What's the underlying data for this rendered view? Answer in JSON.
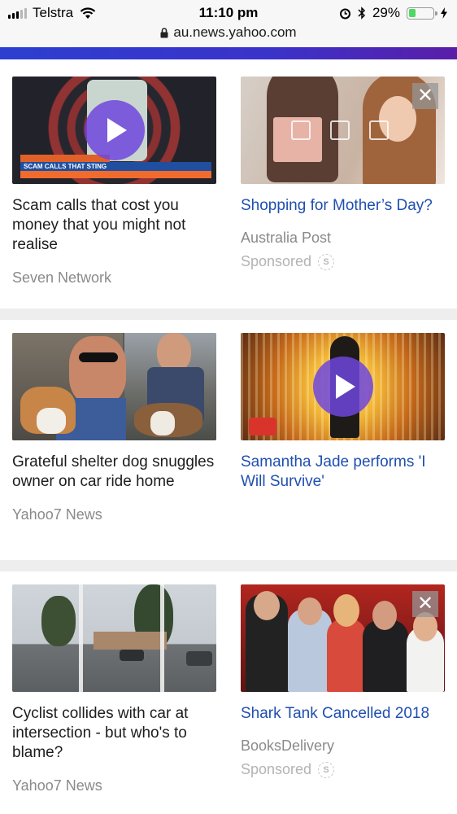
{
  "status_bar": {
    "carrier": "Telstra",
    "time": "11:10 pm",
    "battery_percent": "29%",
    "battery_level": 0.29,
    "url": "au.news.yahoo.com",
    "signal_bars": 5,
    "signal_active": 3
  },
  "rows": [
    {
      "left": {
        "title": "Scam calls that cost you money that you might not realise",
        "source": "Seven Network",
        "thumb_text": "SCAM CALLS THAT STING",
        "has_play": true
      },
      "right": {
        "title": "Shopping for Mother’s Day?",
        "source": "Australia Post",
        "sponsored": "Sponsored",
        "has_close": true
      }
    },
    {
      "left": {
        "title": "Grateful shelter dog snuggles owner on car ride home",
        "source": "Yahoo7 News"
      },
      "right": {
        "title": "Samantha Jade performs 'I Will Survive'",
        "has_play": true
      }
    },
    {
      "left": {
        "title": "Cyclist collides with car at intersection - but who's to blame?",
        "source": "Yahoo7 News"
      },
      "right": {
        "title": "Shark Tank Cancelled 2018",
        "source": "BooksDelivery",
        "sponsored": "Sponsored",
        "has_close": true
      }
    }
  ],
  "colors": {
    "accent_bar_start": "#2d3fd0",
    "accent_bar_end": "#5a1ea8",
    "ad_title": "#1f4fb0",
    "article_title": "#1d1d1d",
    "source_text": "#8a8a8a",
    "battery": "#4cd964"
  },
  "icons": {
    "play": "play-icon",
    "close": "close-icon",
    "sponsored": "sponsored-info-icon",
    "lock": "lock-icon",
    "wifi": "wifi-icon",
    "alarm": "alarm-icon",
    "bluetooth": "bluetooth-icon",
    "charging": "charging-icon"
  }
}
